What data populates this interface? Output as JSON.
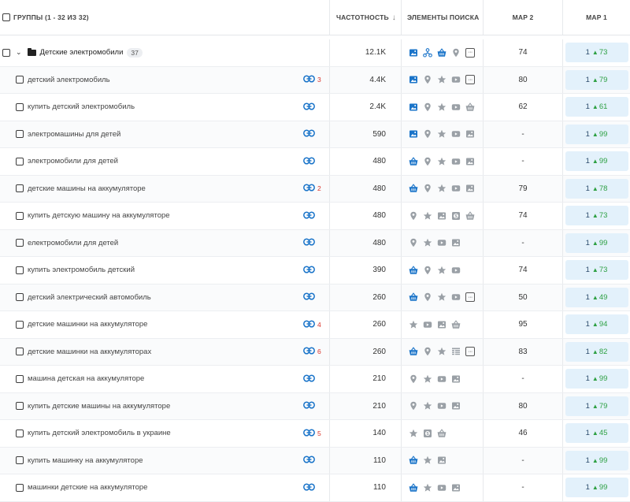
{
  "header": {
    "groups_label": "ГРУППЫ (1 - 32 ИЗ 32)",
    "frequency_label": "ЧАСТОТНОСТЬ",
    "frequency_sort_icon": "arrow-down-icon",
    "features_label": "ЭЛЕМЕНТЫ ПОИСКА",
    "map2_label": "MAP 2",
    "map1_label": "MAP 1"
  },
  "colors": {
    "accent": "#1a74c9",
    "feature_gray": "#9aa0a6",
    "link_count_red": "#d9342b",
    "map1_bg": "#e3f1fb",
    "trend_green": "#2ea043"
  },
  "group": {
    "name": "Детские электромобили",
    "count": "37",
    "freq": "12.1K",
    "features": [
      "image-icon",
      "sitelinks-icon",
      "shopping-basket-icon",
      "location-pin-icon",
      "more-icon"
    ],
    "map2": "74",
    "map1_pos": "1",
    "map1_delta": "73"
  },
  "rows": [
    {
      "kw": "детский электромобиль",
      "links": "3",
      "freq": "4.4K",
      "features": [
        "image-icon",
        "location-pin-icon",
        "star-icon",
        "video-icon",
        "more-icon"
      ],
      "map2": "80",
      "map1_pos": "1",
      "map1_delta": "79"
    },
    {
      "kw": "купить детский электромобиль",
      "links": "",
      "freq": "2.4K",
      "features": [
        "image-icon",
        "location-pin-icon",
        "star-icon",
        "video-icon",
        "shopping-basket-icon"
      ],
      "map2": "62",
      "map1_pos": "1",
      "map1_delta": "61"
    },
    {
      "kw": "электромашины для детей",
      "links": "",
      "freq": "590",
      "features": [
        "image-icon",
        "location-pin-icon",
        "star-icon",
        "video-icon",
        "image-icon"
      ],
      "map2": "-",
      "map1_pos": "1",
      "map1_delta": "99"
    },
    {
      "kw": "электромобили для детей",
      "links": "",
      "freq": "480",
      "features": [
        "shopping-basket-icon",
        "location-pin-icon",
        "star-icon",
        "video-icon",
        "image-icon"
      ],
      "map2": "-",
      "map1_pos": "1",
      "map1_delta": "99"
    },
    {
      "kw": "детские машины на аккумуляторе",
      "links": "2",
      "freq": "480",
      "features": [
        "shopping-basket-icon",
        "location-pin-icon",
        "star-icon",
        "video-icon",
        "image-icon"
      ],
      "map2": "79",
      "map1_pos": "1",
      "map1_delta": "78"
    },
    {
      "kw": "купить детскую машину на аккумуляторе",
      "links": "",
      "freq": "480",
      "features": [
        "location-pin-icon",
        "star-icon",
        "image-icon",
        "currency-icon",
        "shopping-basket-icon"
      ],
      "map2": "74",
      "map1_pos": "1",
      "map1_delta": "73"
    },
    {
      "kw": "електромобили для детей",
      "links": "",
      "freq": "480",
      "features": [
        "location-pin-icon",
        "star-icon",
        "video-icon",
        "image-icon"
      ],
      "map2": "-",
      "map1_pos": "1",
      "map1_delta": "99"
    },
    {
      "kw": "купить электромобиль детский",
      "links": "",
      "freq": "390",
      "features": [
        "shopping-basket-icon",
        "location-pin-icon",
        "star-icon",
        "video-icon"
      ],
      "map2": "74",
      "map1_pos": "1",
      "map1_delta": "73"
    },
    {
      "kw": "детский электрический автомобиль",
      "links": "",
      "freq": "260",
      "features": [
        "shopping-basket-icon",
        "location-pin-icon",
        "star-icon",
        "video-icon",
        "more-icon"
      ],
      "map2": "50",
      "map1_pos": "1",
      "map1_delta": "49"
    },
    {
      "kw": "детские машинки на аккумуляторе",
      "links": "4",
      "freq": "260",
      "features": [
        "star-icon",
        "video-icon",
        "image-icon",
        "shopping-basket-icon"
      ],
      "map2": "95",
      "map1_pos": "1",
      "map1_delta": "94"
    },
    {
      "kw": "детские машинки на аккумуляторах",
      "links": "6",
      "freq": "260",
      "features": [
        "shopping-basket-icon",
        "location-pin-icon",
        "star-icon",
        "list-icon",
        "more-icon"
      ],
      "map2": "83",
      "map1_pos": "1",
      "map1_delta": "82"
    },
    {
      "kw": "машина детская на аккумуляторе",
      "links": "",
      "freq": "210",
      "features": [
        "location-pin-icon",
        "star-icon",
        "video-icon",
        "image-icon"
      ],
      "map2": "-",
      "map1_pos": "1",
      "map1_delta": "99"
    },
    {
      "kw": "купить детские машины на аккумуляторе",
      "links": "",
      "freq": "210",
      "features": [
        "location-pin-icon",
        "star-icon",
        "video-icon",
        "image-icon"
      ],
      "map2": "80",
      "map1_pos": "1",
      "map1_delta": "79"
    },
    {
      "kw": "купить детский электромобиль в украине",
      "links": "5",
      "freq": "140",
      "features": [
        "star-icon",
        "currency-icon",
        "shopping-basket-icon"
      ],
      "map2": "46",
      "map1_pos": "1",
      "map1_delta": "45"
    },
    {
      "kw": "купить машинку на аккумуляторе",
      "links": "",
      "freq": "110",
      "features": [
        "shopping-basket-icon",
        "star-icon",
        "image-icon"
      ],
      "map2": "-",
      "map1_pos": "1",
      "map1_delta": "99"
    },
    {
      "kw": "машинки детские на аккумуляторе",
      "links": "",
      "freq": "110",
      "features": [
        "shopping-basket-icon",
        "star-icon",
        "video-icon",
        "image-icon"
      ],
      "map2": "-",
      "map1_pos": "1",
      "map1_delta": "99"
    }
  ]
}
